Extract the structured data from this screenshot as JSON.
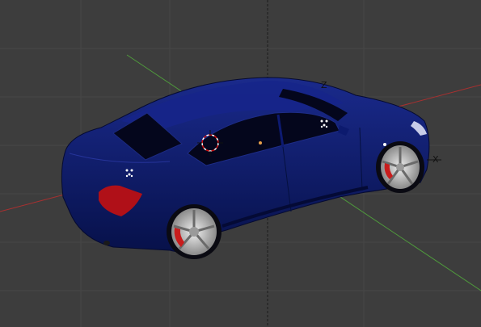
{
  "viewport": {
    "background": "#3d3d3d",
    "grid_color": "#4a4a4a",
    "axis_colors": {
      "x": "#b43232",
      "y": "#4f9a3c",
      "z": "#1c1c1c"
    }
  },
  "axes": {
    "z_label": "Z",
    "x_label": "X"
  },
  "object": {
    "name": "car",
    "body_color": "#0c1a6e",
    "window_color": "#04061c",
    "taillight_color": "#b01018",
    "wheel_color": "#c8c8c8",
    "brake_color": "#c81c1c"
  },
  "cursor": {
    "name": "3d-cursor"
  }
}
